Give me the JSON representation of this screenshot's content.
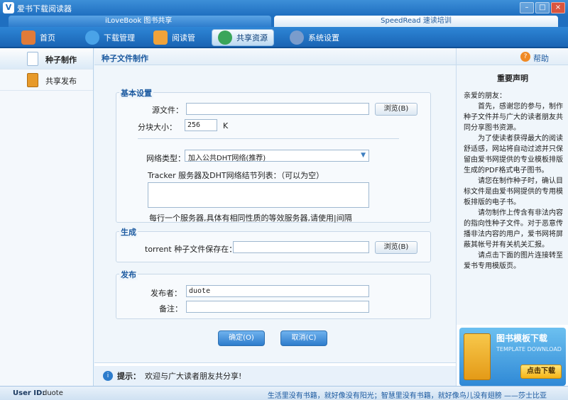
{
  "window": {
    "title": "爱书下载阅读器"
  },
  "banner": {
    "left": "iLoveBook 图书共享",
    "right": "SpeedRead 速读培训"
  },
  "nav": {
    "items": [
      {
        "label": "首页",
        "icon": "home-icon",
        "color": "#e07b39"
      },
      {
        "label": "下载管理",
        "icon": "download-globe-icon",
        "color": "#4aa3e8"
      },
      {
        "label": "阅读管",
        "icon": "reader-icon",
        "color": "#f0a33a"
      },
      {
        "label": "共享资源",
        "icon": "share-globe-icon",
        "color": "#3aa55a",
        "active": true
      },
      {
        "label": "系统设置",
        "icon": "settings-icon",
        "color": "#7a9ccc"
      }
    ]
  },
  "sidebar": {
    "items": [
      {
        "label": "种子制作",
        "active": true
      },
      {
        "label": "共享发布"
      }
    ]
  },
  "main": {
    "header": "种子文件制作",
    "basic": {
      "legend": "基本设置",
      "source_label": "源文件：",
      "source_value": "",
      "browse": "浏览(B)",
      "block_label": "分块大小：",
      "block_value": "256",
      "block_unit": "K",
      "network_label": "网络类型：",
      "network_value": "加入公共DHT网络(推荐)",
      "tracker_label": "Tracker 服务器及DHT网络结节列表：（可以为空）",
      "tracker_hint": "每行一个服务器,具体有相同性质的等效服务器,请使用|间隔"
    },
    "generate": {
      "legend": "生成",
      "save_label": "torrent 种子文件保存在：",
      "save_value": "",
      "browse": "浏览(B)"
    },
    "publish": {
      "legend": "发布",
      "publisher_label": "发布者：",
      "publisher_value": "duote",
      "remark_label": "备注：",
      "remark_value": ""
    },
    "ok": "确定(O)",
    "cancel": "取消(C)",
    "tip_label": "提示：",
    "tip_text": "欢迎与广大读者朋友共分享!"
  },
  "help": {
    "label": "帮助",
    "notice_title": "重要声明",
    "paragraphs": [
      "亲爱的朋友：",
      "首先，感谢您的参与，制作种子文件并与广大的读者朋友共同分享图书资源。",
      "为了使读者获得最大的阅读舒适感，网站将自动过滤并只保留由爱书网提供的专业模板排版生成的PDF格式电子图书。",
      "请您在制作种子时，确认目标文件是由爱书网提供的专用模板排版的电子书。",
      "请勿制作上传含有非法内容的指向性种子文件。对于恶意传播非法内容的用户，爱书网将屏蔽其帐号并有关机关汇报。",
      "请点击下面的图片连接转至爱书专用模版页。"
    ]
  },
  "promo": {
    "title": "图书模板下载",
    "subtitle": "TEMPLATE DOWNLOAD",
    "button": "点击下载"
  },
  "statusbar": {
    "uid_label": "User ID:",
    "uid_value": "duote",
    "quote": "生活里没有书籍，就好像没有阳光；智慧里没有书籍，就好像鸟儿没有翅膀 ——莎士比亚"
  }
}
